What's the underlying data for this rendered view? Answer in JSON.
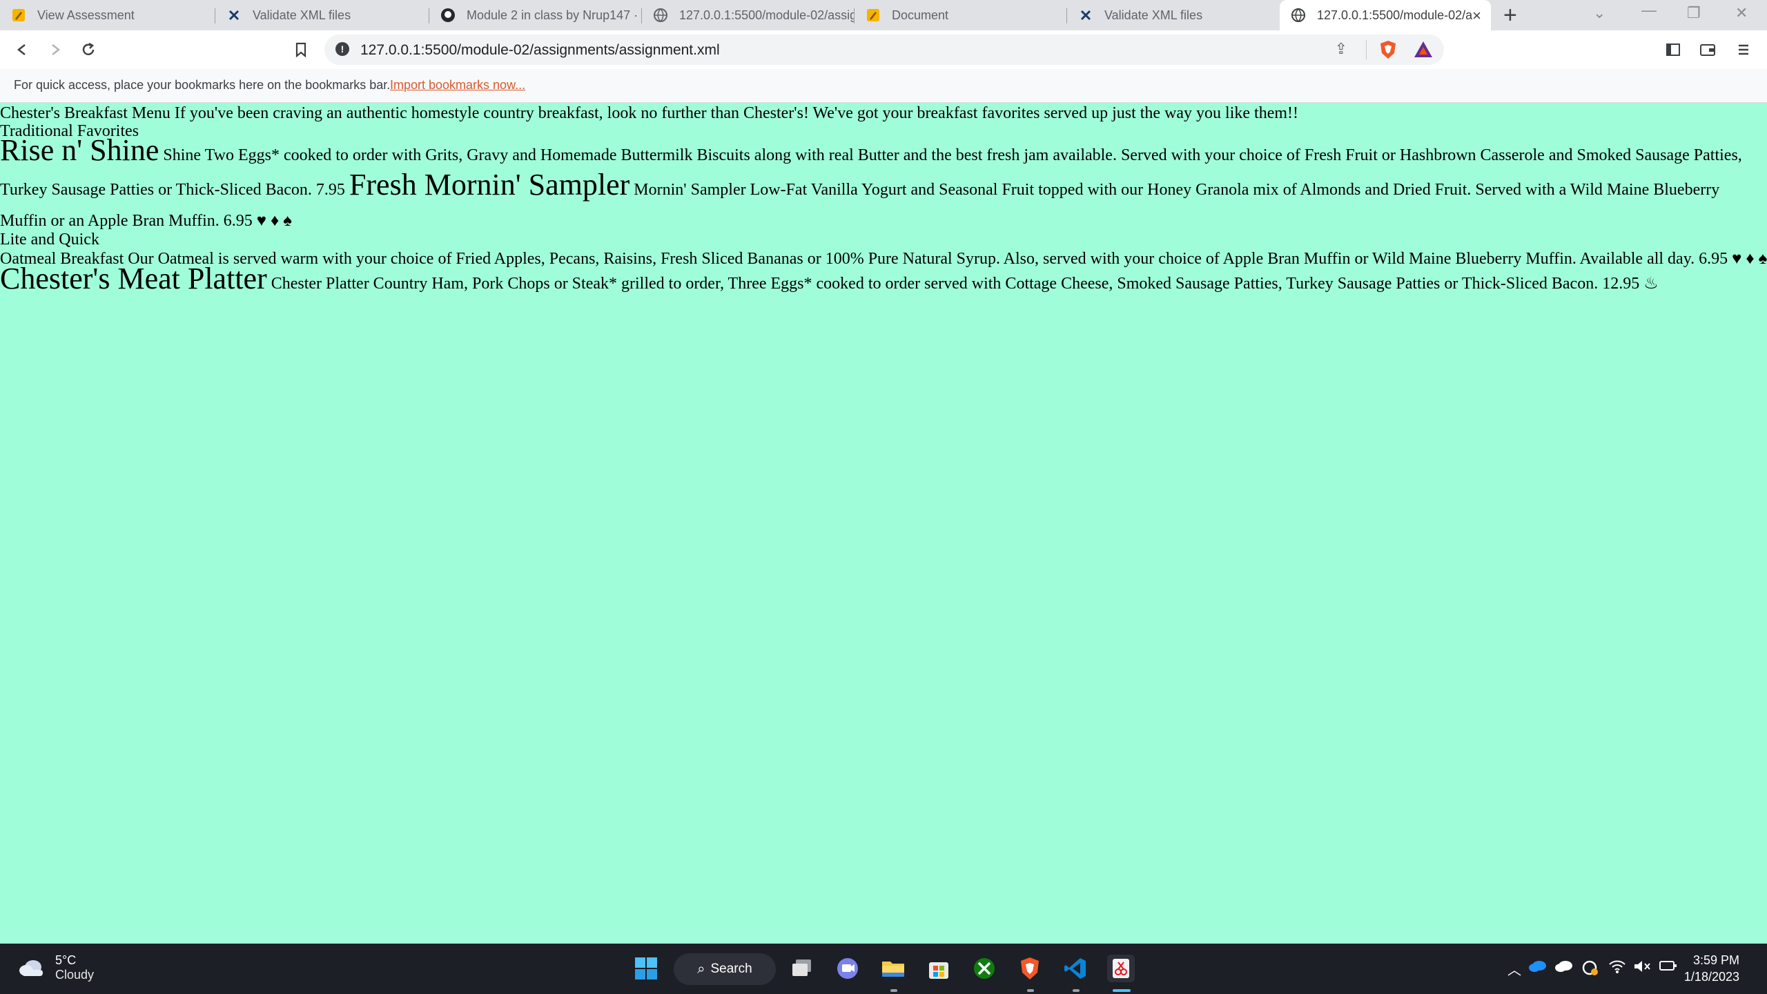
{
  "browser": {
    "tabs": [
      {
        "title": "View Assessment",
        "icon": "pencil-icon"
      },
      {
        "title": "Validate XML files",
        "icon": "x-logo-icon"
      },
      {
        "title": "Module 2 in class by Nrup147 ·",
        "icon": "github-icon"
      },
      {
        "title": "127.0.0.1:5500/module-02/assig",
        "icon": "globe-icon"
      },
      {
        "title": "Document",
        "icon": "pencil-icon"
      },
      {
        "title": "Validate XML files",
        "icon": "x-logo-icon"
      },
      {
        "title": "127.0.0.1:5500/module-02/a",
        "icon": "globe-icon",
        "active": true
      }
    ],
    "new_tab": "+",
    "close_tab": "×",
    "url": "127.0.0.1:5500/module-02/assignments/assignment.xml",
    "bookmarks_message": "For quick access, place your bookmarks here on the bookmarks bar.",
    "import_bookmarks": "Import bookmarks now..."
  },
  "page": {
    "line1": "Chester's Breakfast Menu If you've been craving an authentic homestyle country breakfast, look no further than Chester's! We've got your breakfast favorites served up just the way you like them!!",
    "line2": "Traditional Favorites",
    "item1_title": "Rise n' Shine",
    "item1_desc_a": "Shine Two Eggs* cooked to order with Grits, Gravy and Homemade Buttermilk Biscuits along with real Butter and the best fresh jam available. Served with your choice of Fresh Fruit or Hashbrown Casserole and Smoked Sausage Patties,",
    "item1_desc_b": "Turkey Sausage Patties or Thick-Sliced Bacon. 7.95",
    "item2_title": "Fresh Mornin' Sampler",
    "item2_desc_a": "Mornin' Sampler Low-Fat Vanilla Yogurt and Seasonal Fruit topped with our Honey Granola mix of Almonds and Dried Fruit. Served with a Wild Maine Blueberry",
    "item2_desc_b": "Muffin or an Apple Bran Muffin. 6.95 ♥ ♦ ♠",
    "line_lite": "Lite and Quick",
    "line_oatmeal": "Oatmeal Breakfast Our Oatmeal is served warm with your choice of Fried Apples, Pecans, Raisins, Fresh Sliced Bananas or 100% Pure Natural Syrup. Also, served with your choice of Apple Bran Muffin or Wild Maine Blueberry Muffin. Available all day. 6.95 ♥ ♦ ♠",
    "item3_title": "Chester's Meat Platter",
    "item3_desc": "Chester Platter Country Ham, Pork Chops or Steak* grilled to order, Three Eggs* cooked to order served with Cottage Cheese, Smoked Sausage Patties, Turkey Sausage Patties or Thick-Sliced Bacon. 12.95 ♨"
  },
  "taskbar": {
    "temperature": "5°C",
    "condition": "Cloudy",
    "search": "Search",
    "time": "3:59 PM",
    "date": "1/18/2023"
  },
  "colors": {
    "page_background": "#a0fdd9",
    "taskbar": "#1c1f26",
    "import_link": "#d85a2f"
  }
}
